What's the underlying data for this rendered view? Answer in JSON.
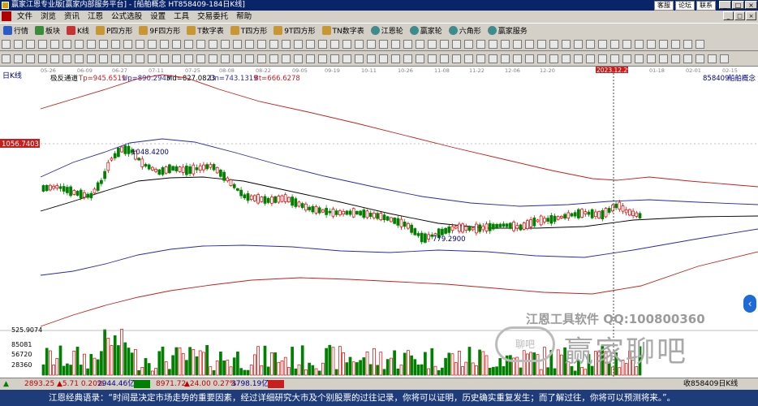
{
  "window": {
    "title": "赢家江恩专业版[赢家内部服务平台] - [船舶概念  HT858409-184日K线]",
    "right_buttons": [
      "客服",
      "论坛",
      "联系"
    ],
    "controls": [
      "_",
      "□",
      "×"
    ]
  },
  "menu": [
    "文件",
    "浏览",
    "资讯",
    "江恩",
    "公式选股",
    "设置",
    "工具",
    "交易委托",
    "帮助"
  ],
  "toolbar": [
    "行情",
    "板块",
    "K线",
    "P四方形",
    "9F四方形",
    "T数字表",
    "T四方形",
    "9T四方形",
    "TN数字表",
    "江恩轮",
    "赢家轮",
    "六角形",
    "赢家服务"
  ],
  "chart": {
    "period_label": "日K线",
    "indicator": "极反通道",
    "tp": "Tp=945.6519",
    "up": "Up=890.2943",
    "md": "Md=827.0823",
    "dn": "Dn=743.1319",
    "bt": "Bt=666.6278",
    "code": "858409",
    "name": "船舶概念",
    "dates": [
      "05-26",
      "06-09",
      "06-27",
      "07-11",
      "07-25",
      "08-08",
      "08-22",
      "09-05",
      "09-19",
      "10-11",
      "10-26",
      "11-08",
      "11-22",
      "12-06",
      "12-20",
      "2023.12.29",
      "01-18",
      "02-01",
      "02-15"
    ],
    "price_marker": "1056.7403",
    "high_label": "1048.4200",
    "low_label": "779.2900",
    "volume_max_label": "525.9074",
    "vol_ticks": [
      "85081",
      "56720",
      "28360"
    ],
    "colors": {
      "up_candle": "#dd0000",
      "down_candle": "#008000",
      "red_line": "#c81e1e",
      "blue_line": "#2828b4",
      "black_line": "#000000"
    }
  },
  "watermark": {
    "line1": "江恩工具软件 QQ:100800360",
    "line2": "赢家聊吧"
  },
  "bottom": {
    "sh_value": "2893.25",
    "sh_change": "▲5.71 0.20%",
    "sh_amount": "2944.46亿",
    "sz_value": "8971.72",
    "sz_change": "▲24.00 0.27%",
    "sz_amount": "3798.19亿",
    "right_label": "收858409日K线"
  },
  "status": {
    "quote": "江恩经典语录：“时间是决定市场走势的重要因素，经过详细研究大市及个别股票的过往记录，你将可以证明，历史确实重复发生；而了解过往，你将可以预测将来。”。"
  }
}
